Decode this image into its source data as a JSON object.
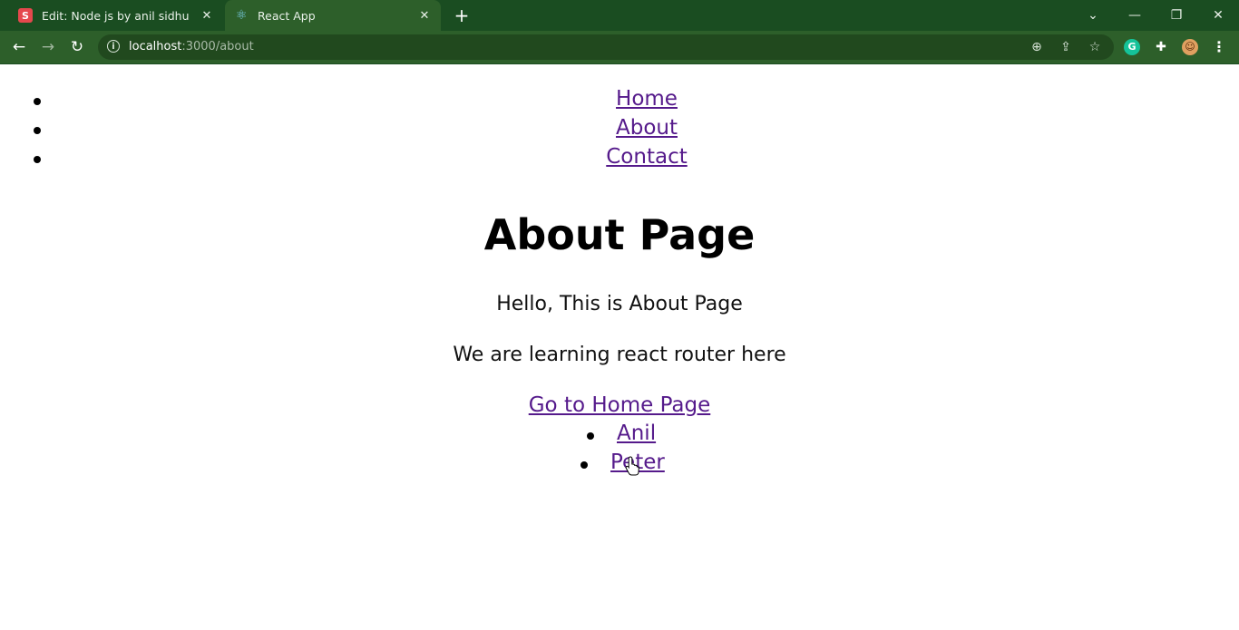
{
  "browser": {
    "tabs": [
      {
        "title": "Edit: Node js by anil sidhu",
        "favicon": "S",
        "active": false
      },
      {
        "title": "React App",
        "favicon": "react-icon",
        "active": true
      }
    ],
    "url": {
      "host": "localhost",
      "path": ":3000/about"
    },
    "colors": {
      "tabbar": "#1a4d21",
      "toolbar": "#2d5f2a",
      "link": "#551a8b"
    }
  },
  "nav": {
    "items": [
      "Home",
      "About",
      "Contact"
    ]
  },
  "page": {
    "title": "About Page",
    "paragraphs": [
      "Hello, This is About Page",
      "We are learning react router here"
    ],
    "home_link": "Go to Home Page",
    "users": [
      "Anil",
      "Peter"
    ]
  }
}
